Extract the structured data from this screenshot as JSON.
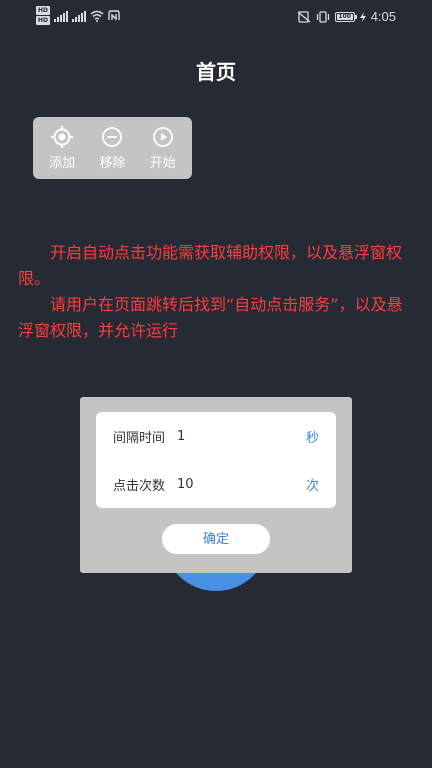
{
  "status_bar": {
    "hd_top": "HD",
    "hd_bottom": "HD",
    "net_1": "4G",
    "net_2": "4G",
    "battery": "100",
    "time": "4:05"
  },
  "page": {
    "title": "首页"
  },
  "toolbar": {
    "items": [
      {
        "label": "添加",
        "icon": "crosshair-icon"
      },
      {
        "label": "移除",
        "icon": "minus-circle-icon"
      },
      {
        "label": "开始",
        "icon": "play-circle-icon"
      }
    ]
  },
  "message": {
    "line1": "开启自动点击功能需获取辅助权限，以及悬浮窗权限。",
    "line2": "请用户在页面跳转后找到“自动点击服务”，以及悬浮窗权限，并允许运行"
  },
  "dialog": {
    "rows": [
      {
        "label": "间隔时间",
        "value": "1",
        "unit": "秒"
      },
      {
        "label": "点击次数",
        "value": "10",
        "unit": "次"
      }
    ],
    "confirm_label": "确定"
  },
  "colors": {
    "background": "#252a34",
    "message_text": "#ff3b3b",
    "accent": "#3a86d4",
    "circle": "#4a90e2",
    "panel": "#c4c4c4"
  }
}
